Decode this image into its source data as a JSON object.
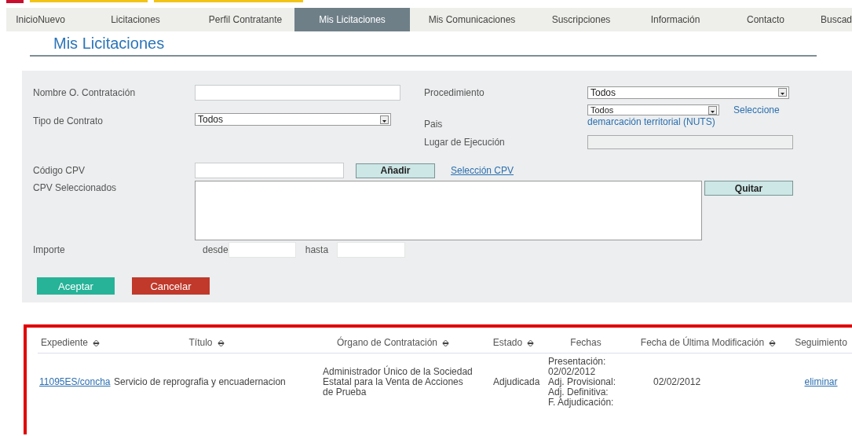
{
  "nav": {
    "tabs": [
      {
        "label": "InicioNuevo",
        "selected": false
      },
      {
        "label": "Licitaciones",
        "selected": false
      },
      {
        "label": "Perfil Contratante",
        "selected": false
      },
      {
        "label": "Mis Licitaciones",
        "selected": true
      },
      {
        "label": "Mis Comunicaciones",
        "selected": false
      },
      {
        "label": "Suscripciones",
        "selected": false
      },
      {
        "label": "Información",
        "selected": false
      },
      {
        "label": "Contacto",
        "selected": false
      },
      {
        "label": "Buscad",
        "selected": false
      }
    ]
  },
  "page_title": "Mis Licitaciones",
  "form": {
    "nombre": {
      "label": "Nombre O. Contratación"
    },
    "procedimiento": {
      "label": "Procedimiento",
      "value": "Todos"
    },
    "tipo_contrato": {
      "label": "Tipo de Contrato",
      "value": "Todos"
    },
    "pais": {
      "label": "Pais",
      "value": "Todos",
      "link_lines": [
        "Seleccione",
        "demarcación territorial (NUTS)"
      ]
    },
    "lugar": {
      "label": "Lugar de Ejecución",
      "disabled": true
    },
    "cpv": {
      "label": "Código CPV",
      "add_button": "Añadir",
      "link": "Selección CPV"
    },
    "cpv_seleccionados": {
      "label": "CPV Seleccionados",
      "remove_button": "Quitar"
    },
    "importe": {
      "label": "Importe",
      "from_label": "desde",
      "to_label": "hasta"
    },
    "buttons": [
      {
        "label": "Aceptar",
        "kind": "accept"
      },
      {
        "label": "Cancelar",
        "kind": "cancel"
      }
    ]
  },
  "table": {
    "columns": [
      {
        "label": "Expediente",
        "sortable": true
      },
      {
        "label": "Título",
        "sortable": true
      },
      {
        "label": "Órgano de Contratación",
        "sortable": true
      },
      {
        "label": "Estado",
        "sortable": true
      },
      {
        "label": "Fechas",
        "sortable": false
      },
      {
        "label": "Fecha de Última Modificación",
        "sortable": true
      },
      {
        "label": "Seguimiento",
        "sortable": false
      }
    ],
    "rows": [
      {
        "expediente": "11095ES/concha",
        "titulo": "Servicio de reprografia y encuadernacion",
        "organo": "Administrador Único de la Sociedad Estatal para la Venta de Acciones de Prueba",
        "estado": "Adjudicada",
        "fechas": [
          "Presentación:",
          "02/02/2012",
          "Adj. Provisional:",
          "Adj. Definitiva:",
          "F. Adjudicación:"
        ],
        "fecha_modificacion": "02/02/2012",
        "seguimiento": "eliminar"
      }
    ]
  }
}
